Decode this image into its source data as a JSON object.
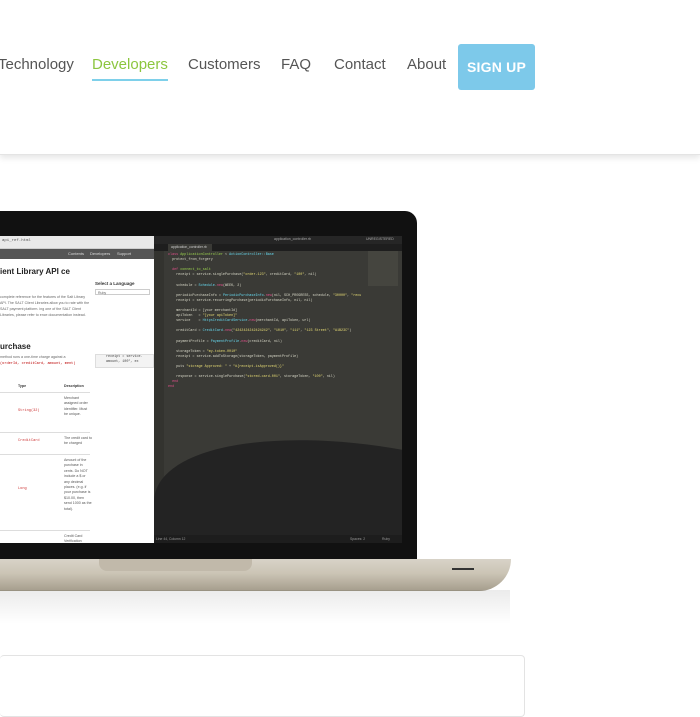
{
  "nav": {
    "items": [
      {
        "label": "Technology",
        "active": false
      },
      {
        "label": "Developers",
        "active": true
      },
      {
        "label": "Customers",
        "active": false
      },
      {
        "label": "FAQ",
        "active": false
      },
      {
        "label": "Contact",
        "active": false
      },
      {
        "label": "About",
        "active": false
      }
    ],
    "signup_label": "SIGN UP",
    "colors": {
      "active": "#8cc63f",
      "underline": "#7ed0ea",
      "signup_bg": "#7dc9ea"
    }
  },
  "laptop_screen": {
    "browser": {
      "url": "api_ref.html",
      "nav_links": [
        "Contents",
        "Developers",
        "Support"
      ],
      "heading": "ient Library API ce",
      "intro": "complete reference for the features of the Salt Library API. The SALT Client Libraries allow you to rate with the SALT payment platform. ing one of the SALT Client Libraries, please refer to ence documentation instead.",
      "language_heading": "Select a Language",
      "language_value": "Ruby",
      "section_heading": "urchase",
      "section_text": "method runs a one-time charge against a",
      "section_code": "(orderId, creditCard, amount, ment)",
      "code_sample": "receipt = service. amount, 100\", ex",
      "table": {
        "headers": [
          "Type",
          "Description"
        ],
        "rows": [
          {
            "type": "String(32)",
            "desc": "Merchant assigned order identifier. Must be unique."
          },
          {
            "type": "CreditCard",
            "desc": "The credit card to be charged"
          },
          {
            "type": "Long",
            "desc": "Amount of the purchase in cents. Do NOT include a $ or any decimal places. (e.g. if your purchase is $10.00, then send 1000 as the total)."
          },
          {
            "type": "",
            "desc": "Credit Card Verification"
          }
        ]
      }
    },
    "editor": {
      "title": "application_controller.rb",
      "title_right": "UNREGISTERED",
      "tab": "application_controller.rb",
      "status_left": "Line 44, Column 12",
      "status_mid": "Spaces: 2",
      "status_right": "Ruby"
    }
  }
}
